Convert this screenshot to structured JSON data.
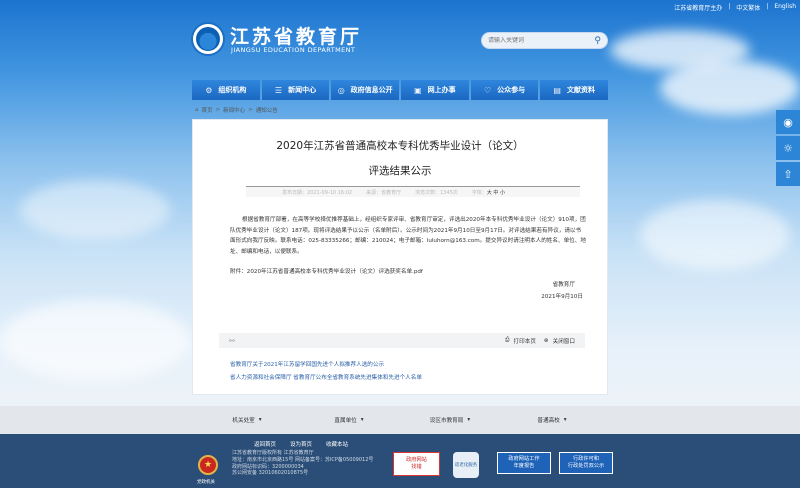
{
  "top_links": [
    "江苏省教育厅主办",
    "中文繁体",
    "English"
  ],
  "site": {
    "title": "江苏省教育厅",
    "subtitle": "JIANGSU EDUCATION DEPARTMENT"
  },
  "search": {
    "placeholder": "请输入关键词"
  },
  "nav": [
    {
      "label": "组织机构",
      "icon": "people-icon"
    },
    {
      "label": "新闻中心",
      "icon": "news-icon"
    },
    {
      "label": "政府信息公开",
      "icon": "info-icon"
    },
    {
      "label": "网上办事",
      "icon": "monitor-icon"
    },
    {
      "label": "公众参与",
      "icon": "heart-icon"
    },
    {
      "label": "文献资料",
      "icon": "document-icon"
    }
  ],
  "breadcrumb": [
    "首页",
    "新闻中心",
    "通知公告"
  ],
  "article": {
    "title_line1": "2020年江苏省普通高校本专科优秀毕业设计（论文）",
    "title_line2": "评选结果公示",
    "meta_date": "发布日期：2021-09-10 16:02",
    "meta_source": "来源：省教育厅",
    "meta_views": "浏览次数：1345次",
    "font_size_label": "字体：",
    "font_size_options": "大 中 小",
    "body": "根据省教育厅部署，在高等学校择优推荐基础上，经组织专家评审、省教育厅审定，评选出2020年本专科优秀毕业设计（论文）910项，团队优秀毕业设计（论文）187项。现将评选结果予以公示（名单附后）。公示时间为2021年9月10日至9月17日。对评选结果若有异议，请以书面形式向我厅反映。联系电话：025-83335266；邮编：210024；电子邮箱：luluhorn@163.com。提交异议时请注明本人的姓名、单位、地址、邮编和电话，以便联系。",
    "attachment": "附件：2020年江苏省普通高校本专科优秀毕业设计（论文）评选获奖名单.pdf",
    "signature": "省教育厅",
    "signature_date": "2021年9月10日"
  },
  "toolbar": {
    "print": "打印本页",
    "close": "关闭窗口"
  },
  "related": [
    "省教育厅关于2021年江苏留学回国先进个人拟推荐人选的公示",
    "省人力资源和社会保障厅 省教育厅公布全省教育系统先进集体和先进个人名单"
  ],
  "footer_links_bar": [
    "机关处室",
    "直属单位",
    "设区市教育局",
    "普通高校"
  ],
  "footer": {
    "links": [
      "返回首页",
      "设为首页",
      "收藏本站"
    ],
    "info": [
      "江苏省教育厅版权所有  江苏省教育厅",
      "地址：南京市北京西路15号  网站备案号：苏ICP备05009012号",
      "政府网站标识码：3200000034",
      "苏公网安备 32010602010875号"
    ],
    "badge_label": "党政机关",
    "report_label": "政府网站\n找错",
    "barrier_label": "适老化服务",
    "annual_report": "政府网站工作\n年度报告",
    "admin_license": "行政许可和\n行政处罚双公示"
  }
}
